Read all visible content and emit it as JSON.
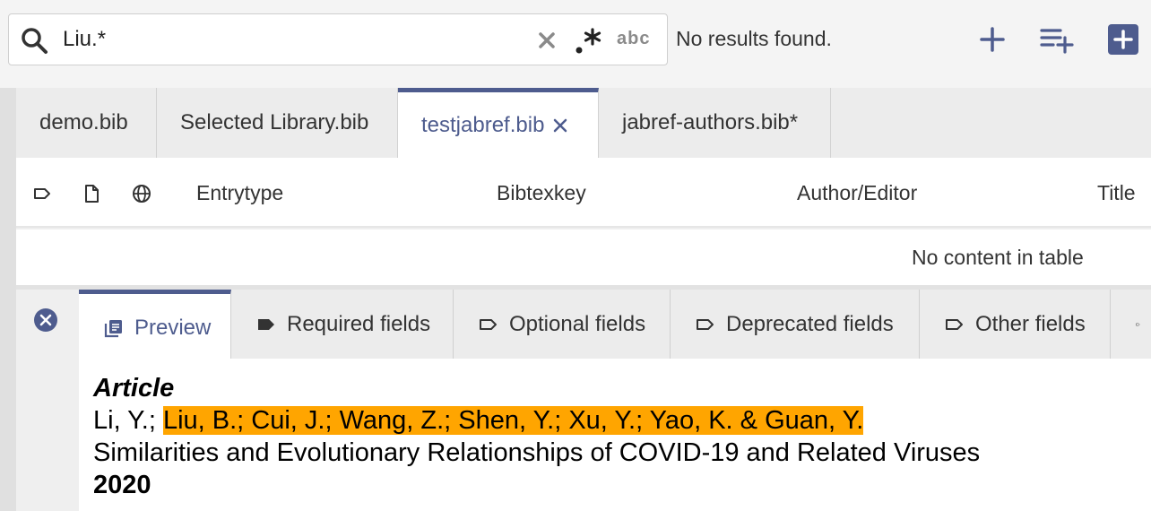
{
  "search": {
    "value": "Liu.*",
    "placeholder": "",
    "clear_icon": "close-icon",
    "regex_icon": "regex-icon",
    "case_label": "abc"
  },
  "status": "No results found.",
  "toolbar_buttons": [
    "add-icon",
    "add-to-list-icon",
    "new-entry-icon"
  ],
  "library_tabs": [
    {
      "label": "demo.bib"
    },
    {
      "label": "Selected Library.bib"
    },
    {
      "label": "testjabref.bib",
      "active": true
    },
    {
      "label": "jabref-authors.bib*"
    }
  ],
  "table": {
    "columns": [
      "Entrytype",
      "Bibtexkey",
      "Author/Editor",
      "Title"
    ],
    "empty_message": "No content in table"
  },
  "editor_tabs": [
    {
      "label": "Preview",
      "active": true
    },
    {
      "label": "Required fields"
    },
    {
      "label": "Optional fields"
    },
    {
      "label": "Deprecated fields"
    },
    {
      "label": "Other fields"
    }
  ],
  "preview": {
    "type": "Article",
    "author_plain": "Li, Y.; ",
    "author_highlight": "Liu, B.; Cui, J.; Wang, Z.; Shen, Y.; Xu, Y.; Yao, K. & Guan, Y.",
    "title": "Similarities and Evolutionary Relationships of COVID-19 and Related Viruses",
    "year": "2020"
  },
  "colors": {
    "accent": "#4e5c8e",
    "highlight": "#ffa500",
    "icon_gray": "#8a8a8a"
  }
}
